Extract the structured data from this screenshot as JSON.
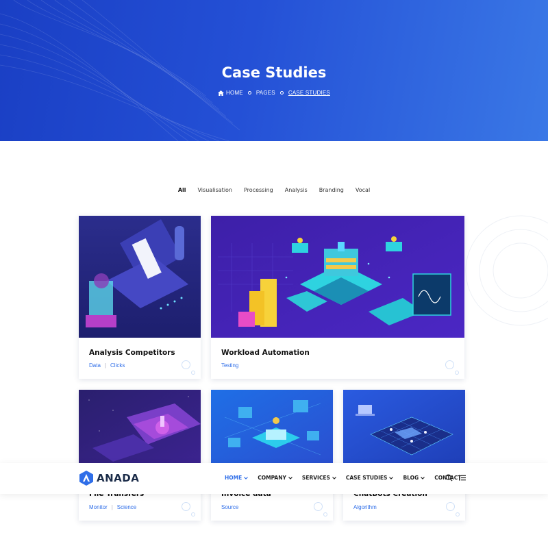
{
  "hero": {
    "title": "Case Studies",
    "breadcrumb": [
      "HOME",
      "PAGES",
      "CASE STUDIES"
    ]
  },
  "filters": [
    "All",
    "Visualisation",
    "Processing",
    "Analysis",
    "Branding",
    "Vocal"
  ],
  "active_filter": "All",
  "cards": [
    {
      "title": "Analysis Competitors",
      "tags": [
        "Data",
        "Clicks"
      ]
    },
    {
      "title": "Workload Automation",
      "tags": [
        "Testing"
      ]
    },
    {
      "title": "File Transfers",
      "tags": [
        "Monitor",
        "Science"
      ]
    },
    {
      "title": "Invoice data",
      "tags": [
        "Source"
      ]
    },
    {
      "title": "ChatBots Creation",
      "tags": [
        "Algorithm"
      ]
    }
  ],
  "navbar": {
    "logo_text": "ANADA",
    "items": [
      "HOME",
      "COMPANY",
      "SERVICES",
      "CASE STUDIES",
      "BLOG",
      "CONTACT"
    ],
    "active_item": "HOME",
    "icons": [
      "search-icon",
      "list-menu-icon"
    ]
  },
  "colors": {
    "hero_start": "#1a3fc4",
    "hero_end": "#3a78e6",
    "accent": "#2f6ee8",
    "text_dark": "#111111",
    "thumb_dark": "#2a2a8f"
  }
}
